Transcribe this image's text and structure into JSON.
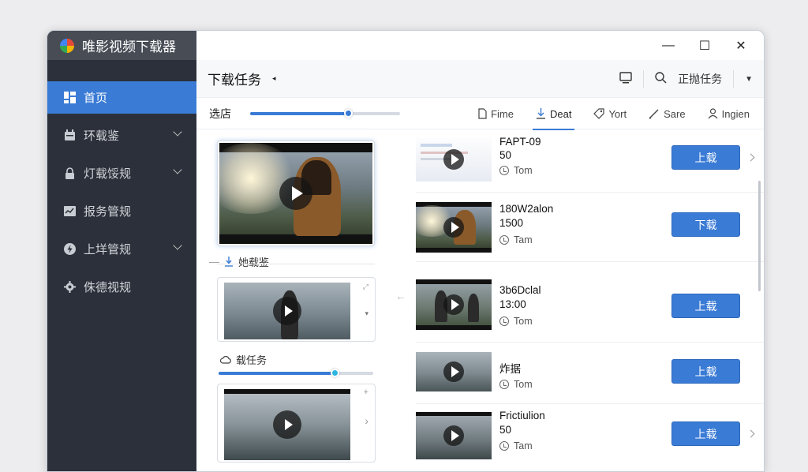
{
  "app": {
    "title": "唯影视频下载器"
  },
  "window_controls": {
    "minimize": "—",
    "maximize": "☐",
    "close": "✕"
  },
  "sidebar": {
    "items": [
      {
        "label": "首页",
        "icon": "dashboard-icon",
        "active": true
      },
      {
        "label": "环载鉴",
        "icon": "calendar-icon",
        "expandable": true
      },
      {
        "label": "灯载馁规",
        "icon": "lock-icon",
        "expandable": true
      },
      {
        "label": "报务管规",
        "icon": "chart-icon"
      },
      {
        "label": "上垟管规",
        "icon": "bolt-icon",
        "expandable": true
      },
      {
        "label": "侏德视规",
        "icon": "gear-icon"
      }
    ]
  },
  "toolbar": {
    "title": "下载任务",
    "device_icon": "monitor-icon",
    "search_label": "正抛任务",
    "dropdown_icon": "caret-down-icon"
  },
  "filter": {
    "label": "选店",
    "progress": 0.65,
    "tabs": [
      {
        "label": "Fime",
        "icon": "file-icon"
      },
      {
        "label": "Deat",
        "icon": "download-icon",
        "active": true
      },
      {
        "label": "Yort",
        "icon": "tag-icon"
      },
      {
        "label": "Sare",
        "icon": "pen-icon"
      },
      {
        "label": "Ingien",
        "icon": "user-icon"
      }
    ]
  },
  "preview": {
    "section1_label": "她载鉴",
    "section2_label": "载任务",
    "section2_progress": 0.75
  },
  "tasks": [
    {
      "title": "FAPT-09",
      "number": "50",
      "user": "Tom",
      "button": "上载"
    },
    {
      "title": "180W2alon",
      "number": "1500",
      "user": "Tam",
      "button": "下载"
    },
    {
      "title": "3b6Dclal",
      "number": "13:00",
      "user": "Tom",
      "button": "上载"
    },
    {
      "title": "炸据",
      "number": "",
      "user": "Tom",
      "button": "上载"
    },
    {
      "title": "Frictiulion",
      "number": "50",
      "user": "Tam",
      "button": "上载"
    }
  ],
  "colors": {
    "accent": "#3a7bd5",
    "sidebar": "#2b303a",
    "titlebar": "#474c55"
  }
}
